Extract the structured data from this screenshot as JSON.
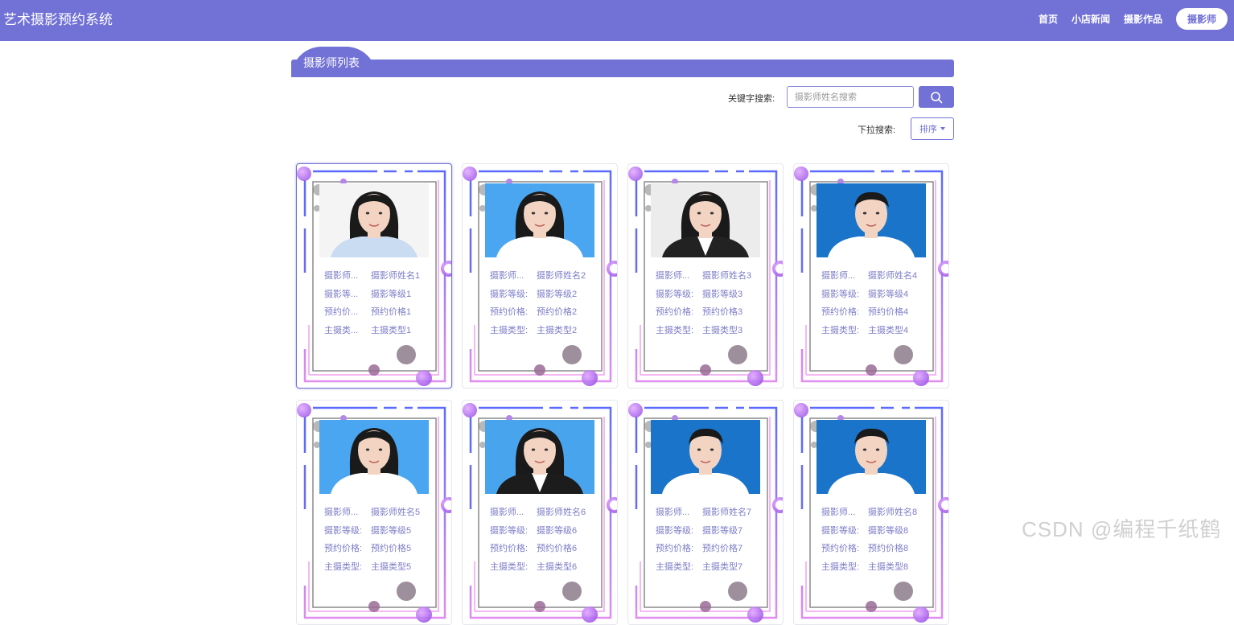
{
  "header": {
    "brand": "艺术摄影预约系统",
    "nav": [
      "首页",
      "小店新闻",
      "摄影作品"
    ],
    "user_pill": "摄影师"
  },
  "section": {
    "title": "摄影师列表"
  },
  "search": {
    "keyword_label": "关键字搜索:",
    "keyword_placeholder": "摄影师姓名搜索",
    "dropdown_label": "下拉搜索:",
    "sort_label": "排序"
  },
  "colors": {
    "accent": "#7171d6"
  },
  "cards": [
    {
      "name_label": "摄影师...",
      "name": "摄影师姓名1",
      "level_label": "摄影等...",
      "level": "摄影等级1",
      "price_label": "预约价...",
      "price": "预约价格1",
      "type_label": "主摄类...",
      "type": "主摄类型1",
      "photo": "female-white-background"
    },
    {
      "name_label": "摄影师...",
      "name": "摄影师姓名2",
      "level_label": "摄影等级:",
      "level": "摄影等级2",
      "price_label": "预约价格:",
      "price": "预约价格2",
      "type_label": "主摄类型:",
      "type": "主摄类型2",
      "photo": "female-blue-background"
    },
    {
      "name_label": "摄影师...",
      "name": "摄影师姓名3",
      "level_label": "摄影等级:",
      "level": "摄影等级3",
      "price_label": "预约价格:",
      "price": "预约价格3",
      "type_label": "主摄类型:",
      "type": "主摄类型3",
      "photo": "female-suit-grey-background"
    },
    {
      "name_label": "摄影师...",
      "name": "摄影师姓名4",
      "level_label": "摄影等级:",
      "level": "摄影等级4",
      "price_label": "预约价格:",
      "price": "预约价格4",
      "type_label": "主摄类型:",
      "type": "主摄类型4",
      "photo": "male-white-shirt-blue-background"
    },
    {
      "name_label": "摄影师...",
      "name": "摄影师姓名5",
      "level_label": "摄影等级:",
      "level": "摄影等级5",
      "price_label": "预约价格:",
      "price": "预约价格5",
      "type_label": "主摄类型:",
      "type": "主摄类型5",
      "photo": "female-blue-background"
    },
    {
      "name_label": "摄影师...",
      "name": "摄影师姓名6",
      "level_label": "摄影等级:",
      "level": "摄影等级6",
      "price_label": "预约价格:",
      "price": "预约价格6",
      "type_label": "主摄类型:",
      "type": "主摄类型6",
      "photo": "female-suit-blue-background"
    },
    {
      "name_label": "摄影师...",
      "name": "摄影师姓名7",
      "level_label": "摄影等级:",
      "level": "摄影等级7",
      "price_label": "预约价格:",
      "price": "预约价格7",
      "type_label": "主摄类型:",
      "type": "主摄类型7",
      "photo": "male-white-shirt-blue-background"
    },
    {
      "name_label": "摄影师...",
      "name": "摄影师姓名8",
      "level_label": "摄影等级:",
      "level": "摄影等级8",
      "price_label": "预约价格:",
      "price": "预约价格8",
      "type_label": "主摄类型:",
      "type": "主摄类型8",
      "photo": "male-white-shirt-blue-background"
    }
  ],
  "watermark": "CSDN @编程千纸鹤"
}
